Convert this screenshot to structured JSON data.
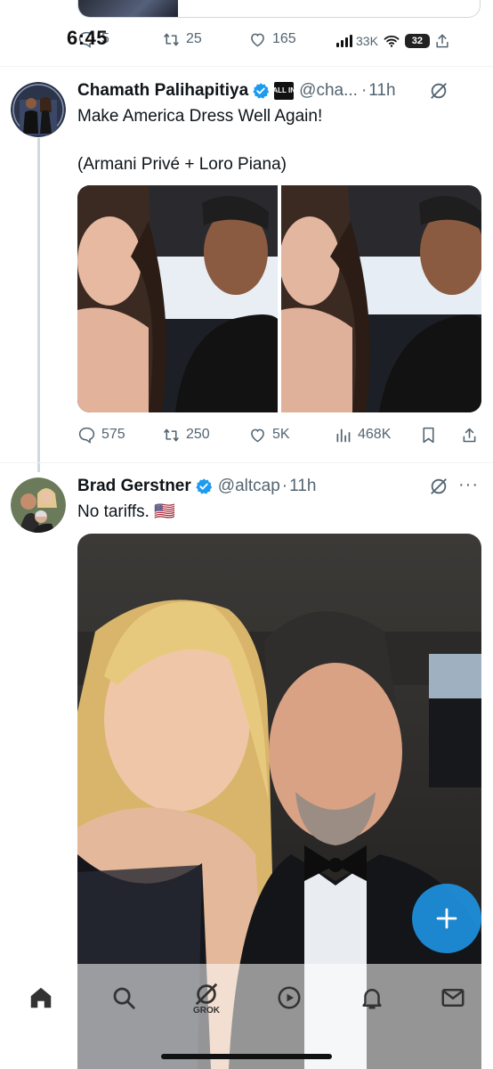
{
  "status_bar": {
    "time": "6:45",
    "battery": "32"
  },
  "previous_tweet": {
    "reply_count": "5",
    "repost_count": "25",
    "like_count": "165",
    "view_count": "33K"
  },
  "tweets": [
    {
      "author_name": "Chamath Palihapitiya",
      "affiliate_badge": "ALL IN",
      "handle": "@cha...",
      "time": "11h",
      "text_line1": "Make America Dress Well Again!",
      "text_line2": "(Armani Privé + Loro Piana)",
      "reply_count": "575",
      "repost_count": "250",
      "like_count": "5K",
      "view_count": "468K"
    },
    {
      "author_name": "Brad Gerstner",
      "handle": "@altcap",
      "time": "11h",
      "text": "No tariffs. 🇺🇸"
    }
  ],
  "bottom_nav": {
    "grok_label": "GROK"
  },
  "colors": {
    "accent": "#1d9bf0",
    "secondary_text": "#536471",
    "divider": "#eff3f4"
  },
  "icons": [
    "reply-icon",
    "repost-icon",
    "like-icon",
    "views-icon",
    "bookmark-icon",
    "share-icon",
    "grok-icon",
    "more-icon",
    "verified-icon",
    "compose-icon",
    "home-icon",
    "search-icon",
    "video-icon",
    "notifications-icon",
    "messages-icon"
  ]
}
